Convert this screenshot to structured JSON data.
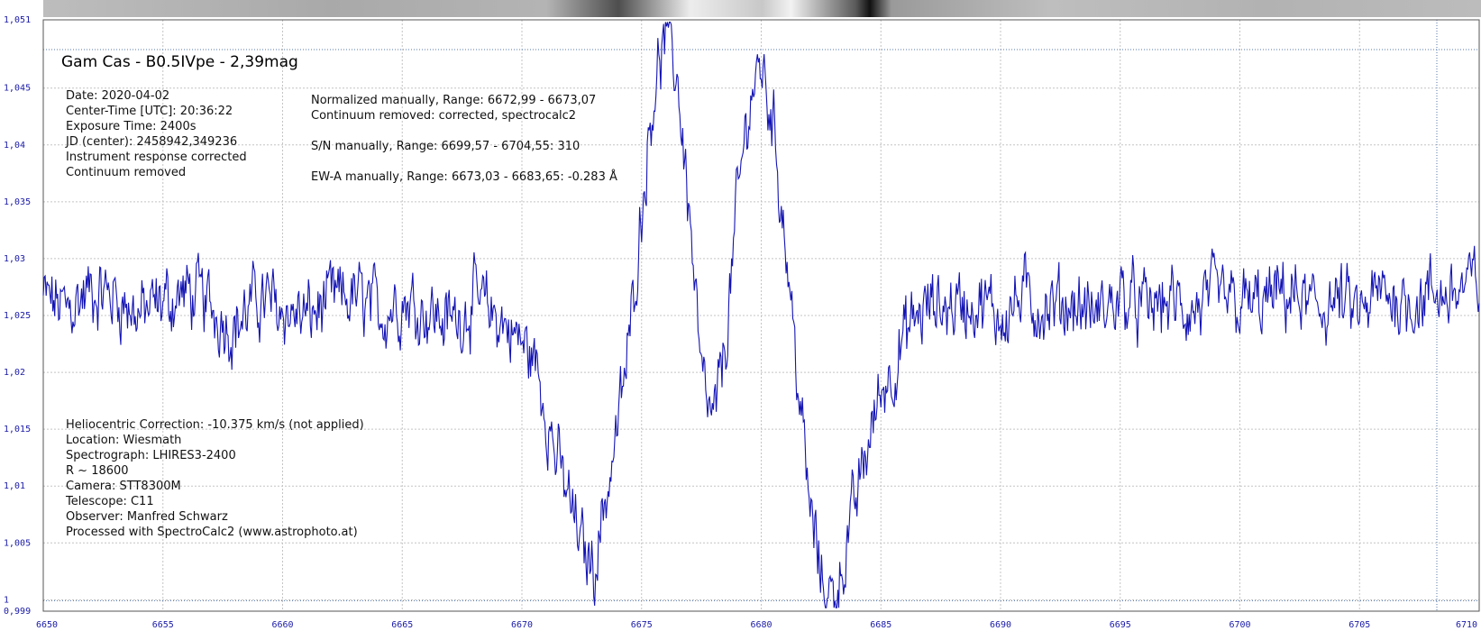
{
  "chart_data": {
    "type": "line",
    "title": "Gam Cas - B0.5IVpe - 2,39mag",
    "xlabel": "",
    "ylabel": "",
    "xlim": [
      6650,
      6710
    ],
    "ylim": [
      0.999,
      1.051
    ],
    "x_ticks": [
      6650,
      6655,
      6660,
      6665,
      6670,
      6675,
      6680,
      6685,
      6690,
      6695,
      6700,
      6705,
      6710
    ],
    "x_tick_labels": [
      "6650",
      "6655",
      "6660",
      "6665",
      "6670",
      "6675",
      "6680",
      "6685",
      "6690",
      "6695",
      "6700",
      "6705",
      "6710"
    ],
    "y_ticks": [
      0.999,
      1.0,
      1.005,
      1.01,
      1.015,
      1.02,
      1.025,
      1.03,
      1.035,
      1.04,
      1.045,
      1.051
    ],
    "y_tick_labels": [
      "0,999",
      "1",
      "1,005",
      "1,01",
      "1,015",
      "1,02",
      "1,025",
      "1,03",
      "1,035",
      "1,04",
      "1,045",
      "1,051"
    ],
    "grid": true,
    "line_color": "#1414b4",
    "series": [
      {
        "x": [
          6650.0,
          6651.0,
          6652.0,
          6653.0,
          6654.0,
          6655.0,
          6656.0,
          6657.0,
          6658.0,
          6659.0,
          6660.0,
          6661.0,
          6662.0,
          6663.0,
          6664.0,
          6665.0,
          6666.0,
          6667.0,
          6668.0,
          6669.0,
          6669.5,
          6670.0,
          6670.5,
          6671.0,
          6671.5,
          6672.0,
          6672.5,
          6673.0,
          6673.5,
          6674.0,
          6674.5,
          6675.0,
          6675.5,
          6676.0,
          6676.5,
          6677.0,
          6677.5,
          6678.0,
          6678.5,
          6679.0,
          6679.5,
          6680.0,
          6680.5,
          6681.0,
          6681.5,
          6682.0,
          6682.5,
          6683.0,
          6683.5,
          6684.0,
          6684.5,
          6685.0,
          6685.5,
          6686.0,
          6686.5,
          6687.0,
          6688.0,
          6689.0,
          6690.0,
          6691.0,
          6692.0,
          6693.0,
          6694.0,
          6695.0,
          6696.0,
          6697.0,
          6698.0,
          6699.0,
          6700.0,
          6701.0,
          6702.0,
          6703.0,
          6704.0,
          6705.0,
          6706.0,
          6707.0,
          6708.0,
          6709.0,
          6710.0
        ],
        "y": [
          1.0265,
          1.0255,
          1.0272,
          1.0268,
          1.025,
          1.0262,
          1.027,
          1.0258,
          1.024,
          1.0265,
          1.0255,
          1.0248,
          1.0262,
          1.0266,
          1.0252,
          1.0265,
          1.0255,
          1.0244,
          1.0262,
          1.0248,
          1.0238,
          1.0225,
          1.0212,
          1.017,
          1.012,
          1.0085,
          1.0045,
          1.003,
          1.009,
          1.015,
          1.023,
          1.0345,
          1.045,
          1.0495,
          1.046,
          1.034,
          1.019,
          1.015,
          1.0225,
          1.0345,
          1.044,
          1.047,
          1.042,
          1.032,
          1.02,
          1.0085,
          1.002,
          1.0,
          1.004,
          1.009,
          1.014,
          1.0185,
          1.0205,
          1.023,
          1.0248,
          1.0258,
          1.026,
          1.0262,
          1.025,
          1.0266,
          1.0255,
          1.0262,
          1.025,
          1.0267,
          1.0255,
          1.0262,
          1.0252,
          1.0265,
          1.0258,
          1.026,
          1.027,
          1.0255,
          1.0262,
          1.025,
          1.027,
          1.0262,
          1.0268,
          1.027,
          1.028
        ]
      }
    ]
  },
  "info": {
    "block1": [
      "Date: 2020-04-02",
      "Center-Time [UTC]: 20:36:22",
      "Exposure Time: 2400s",
      "JD (center): 2458942,349236",
      "Instrument response corrected",
      "Continuum removed"
    ],
    "block2": [
      "Normalized manually, Range: 6672,99 - 6673,07",
      "Continuum removed: corrected, spectrocalc2",
      "",
      "S/N manually, Range: 6699,57 - 6704,55: 310",
      "",
      "EW-A manually, Range: 6673,03 - 6683,65: -0.283 Å"
    ],
    "block3": [
      "Heliocentric Correction: -10.375 km/s (not applied)",
      "Location: Wiesmath",
      "Spectrograph: LHIRES3-2400",
      "R ~ 18600",
      "Camera: STT8300M",
      "Telescope: C11",
      "Observer: Manfred Schwarz",
      "Processed with SpectroCalc2 (www.astrophoto.at)"
    ]
  }
}
